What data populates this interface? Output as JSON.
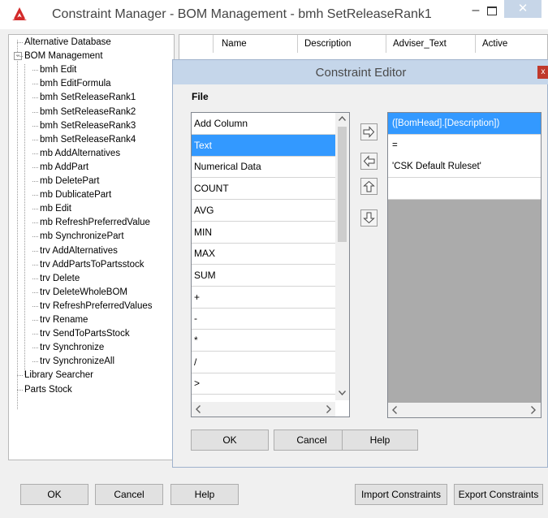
{
  "window": {
    "title": "Constraint Manager - BOM Management - bmh SetReleaseRank1",
    "minimize_glyph": "–",
    "close_glyph": "✕",
    "accent_color": "#c7d6e8"
  },
  "tree": {
    "items": [
      {
        "label": "Alternative Database",
        "level": 0
      },
      {
        "label": "BOM Management",
        "level": 0,
        "expander": "−"
      },
      {
        "label": "bmh Edit",
        "level": 1
      },
      {
        "label": "bmh EditFormula",
        "level": 1
      },
      {
        "label": "bmh SetReleaseRank1",
        "level": 1
      },
      {
        "label": "bmh SetReleaseRank2",
        "level": 1
      },
      {
        "label": "bmh SetReleaseRank3",
        "level": 1
      },
      {
        "label": "bmh SetReleaseRank4",
        "level": 1
      },
      {
        "label": "mb AddAlternatives",
        "level": 1
      },
      {
        "label": "mb AddPart",
        "level": 1
      },
      {
        "label": "mb DeletePart",
        "level": 1
      },
      {
        "label": "mb DublicatePart",
        "level": 1
      },
      {
        "label": "mb Edit",
        "level": 1
      },
      {
        "label": "mb RefreshPreferredValue",
        "level": 1
      },
      {
        "label": "mb SynchronizePart",
        "level": 1
      },
      {
        "label": "trv AddAlternatives",
        "level": 1
      },
      {
        "label": "trv AddPartsToPartsstock",
        "level": 1
      },
      {
        "label": "trv Delete",
        "level": 1
      },
      {
        "label": "trv DeleteWholeBOM",
        "level": 1
      },
      {
        "label": "trv RefreshPreferredValues",
        "level": 1
      },
      {
        "label": "trv Rename",
        "level": 1
      },
      {
        "label": "trv SendToPartsStock",
        "level": 1
      },
      {
        "label": "trv Synchronize",
        "level": 1
      },
      {
        "label": "trv SynchronizeAll",
        "level": 1
      },
      {
        "label": "Library Searcher",
        "level": 0
      },
      {
        "label": "Parts Stock",
        "level": 0
      }
    ]
  },
  "grid": {
    "columns": [
      "Name",
      "Description",
      "Adviser_Text",
      "Active"
    ]
  },
  "footer": {
    "ok": "OK",
    "cancel": "Cancel",
    "help": "Help",
    "import": "Import Constraints",
    "export": "Export Constraints"
  },
  "editor": {
    "title": "Constraint Editor",
    "close_glyph": "x",
    "file_menu": "File",
    "columns_list": {
      "items": [
        "Add Column",
        "Text",
        "Numerical Data",
        "COUNT",
        "AVG",
        "MIN",
        "MAX",
        "SUM",
        "+",
        "-",
        "*",
        "/",
        ">",
        "<"
      ],
      "selected_index": 1
    },
    "expression_list": {
      "items": [
        "([BomHead].[Description])",
        "=",
        "'CSK Default Ruleset'",
        ""
      ],
      "selected_index": 0
    },
    "arrow_icons": [
      "arrow-right-icon",
      "arrow-left-icon",
      "arrow-up-icon",
      "arrow-down-icon"
    ],
    "buttons": {
      "ok": "OK",
      "cancel": "Cancel",
      "help": "Help"
    },
    "selection_color": "#3399ff"
  }
}
